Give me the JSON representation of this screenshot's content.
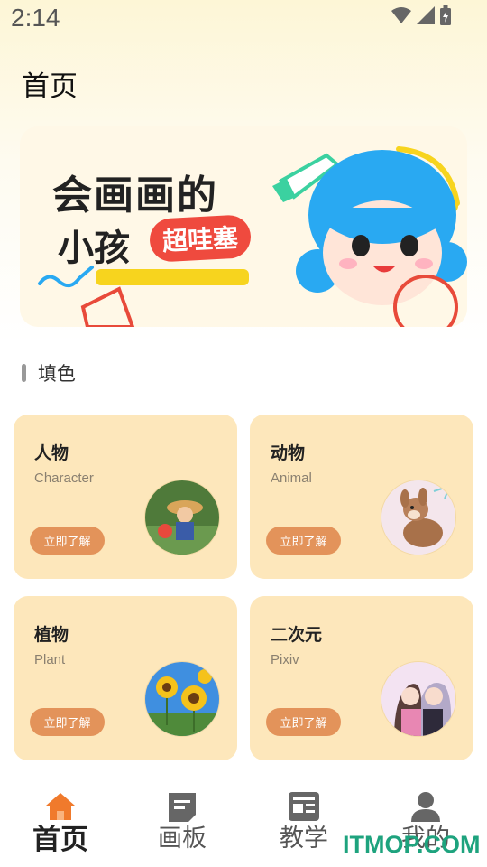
{
  "status_bar": {
    "time": "2:14",
    "icons": [
      "wifi-icon",
      "signal-icon",
      "battery-charging-icon"
    ]
  },
  "header": {
    "title": "首页"
  },
  "banner": {
    "line1": "会画画的",
    "line2": "小孩",
    "tag": "超哇塞"
  },
  "section": {
    "title": "填色"
  },
  "cards": [
    {
      "title": "人物",
      "subtitle": "Character",
      "button": "立即了解",
      "image": "character-artwork"
    },
    {
      "title": "动物",
      "subtitle": "Animal",
      "button": "立即了解",
      "image": "animal-artwork"
    },
    {
      "title": "植物",
      "subtitle": "Plant",
      "button": "立即了解",
      "image": "sunflower-artwork"
    },
    {
      "title": "二次元",
      "subtitle": "Pixiv",
      "button": "立即了解",
      "image": "anime-artwork"
    }
  ],
  "nav": [
    {
      "label": "首页",
      "icon": "home-icon",
      "active": true
    },
    {
      "label": "画板",
      "icon": "canvas-icon",
      "active": false
    },
    {
      "label": "教学",
      "icon": "teach-icon",
      "active": false
    },
    {
      "label": "我的",
      "icon": "profile-icon",
      "active": false
    }
  ],
  "watermark": "ITMOP.COM",
  "colors": {
    "card_bg": "#fde7bb",
    "button": "#e3935a",
    "accent": "#f07a2c",
    "watermark": "#1ea37e"
  }
}
